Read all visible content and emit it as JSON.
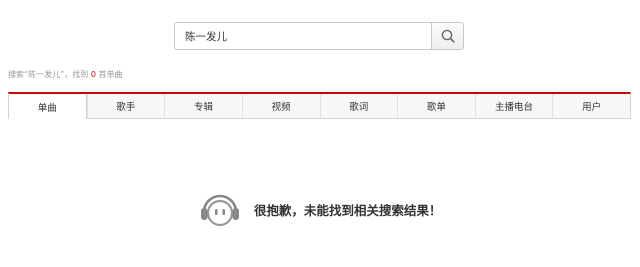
{
  "search": {
    "value": "陈一发儿",
    "button_icon": "search-icon"
  },
  "summary": {
    "prefix": "搜索“陈一发儿”，找到",
    "count": "0",
    "suffix": "首单曲"
  },
  "tabs": [
    {
      "label": "单曲",
      "active": true
    },
    {
      "label": "歌手",
      "active": false
    },
    {
      "label": "专辑",
      "active": false
    },
    {
      "label": "视频",
      "active": false
    },
    {
      "label": "歌词",
      "active": false
    },
    {
      "label": "歌单",
      "active": false
    },
    {
      "label": "主播电台",
      "active": false
    },
    {
      "label": "用户",
      "active": false
    }
  ],
  "empty_state": {
    "icon": "headphones-face-icon",
    "message": "很抱歉，未能找到相关搜索结果！"
  },
  "colors": {
    "accent": "#c20c0c",
    "border": "#c9c9c9",
    "muted_text": "#999999"
  }
}
